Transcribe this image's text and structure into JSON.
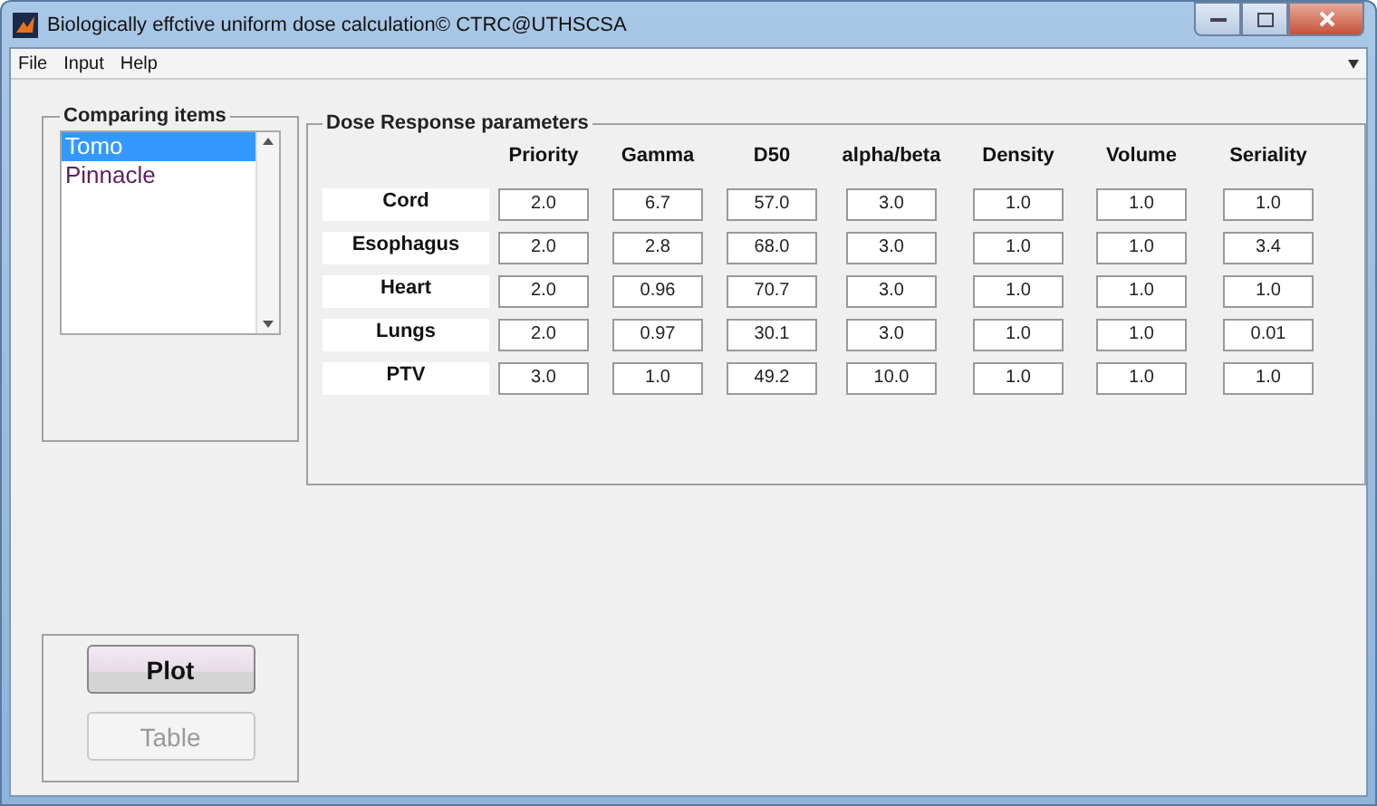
{
  "window": {
    "title": "Biologically effctive uniform dose calculation© CTRC@UTHSCSA"
  },
  "menu": [
    "File",
    "Input",
    "Help"
  ],
  "comparing_items": {
    "title": "Comparing items",
    "items": [
      {
        "label": "Tomo",
        "selected": true
      },
      {
        "label": "Pinnacle",
        "selected": false
      }
    ]
  },
  "dose_response": {
    "title": "Dose Response parameters",
    "columns": [
      "Priority",
      "Gamma",
      "D50",
      "alpha/beta",
      "Density",
      "Volume",
      "Seriality"
    ],
    "rows": [
      {
        "name": "Cord",
        "values": [
          "2.0",
          "6.7",
          "57.0",
          "3.0",
          "1.0",
          "1.0",
          "1.0"
        ]
      },
      {
        "name": "Esophagus",
        "values": [
          "2.0",
          "2.8",
          "68.0",
          "3.0",
          "1.0",
          "1.0",
          "3.4"
        ]
      },
      {
        "name": "Heart",
        "values": [
          "2.0",
          "0.96",
          "70.7",
          "3.0",
          "1.0",
          "1.0",
          "1.0"
        ]
      },
      {
        "name": "Lungs",
        "values": [
          "2.0",
          "0.97",
          "30.1",
          "3.0",
          "1.0",
          "1.0",
          "0.01"
        ]
      },
      {
        "name": "PTV",
        "values": [
          "3.0",
          "1.0",
          "49.2",
          "10.0",
          "1.0",
          "1.0",
          "1.0"
        ]
      }
    ]
  },
  "buttons": [
    {
      "label": "Plot",
      "disabled": false
    },
    {
      "label": "Table",
      "disabled": true
    }
  ]
}
